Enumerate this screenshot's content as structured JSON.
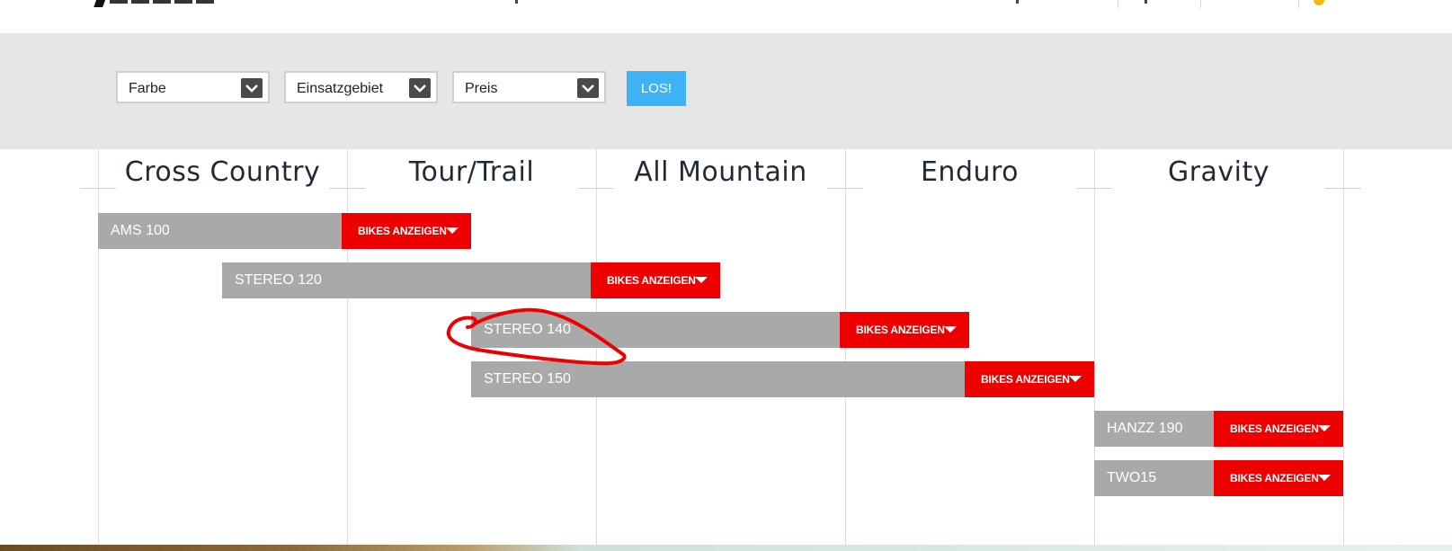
{
  "filters": {
    "color_label": "Farbe",
    "usage_label": "Einsatzgebiet",
    "price_label": "Preis",
    "go_label": "LOS!"
  },
  "categories": [
    "Cross Country",
    "Tour/Trail",
    "All Mountain",
    "Enduro",
    "Gravity"
  ],
  "bikes": [
    {
      "name": "AMS 100",
      "button": "BIKES ANZEIGEN"
    },
    {
      "name": "STEREO 120",
      "button": "BIKES ANZEIGEN"
    },
    {
      "name": "STEREO 140",
      "button": "BIKES ANZEIGEN"
    },
    {
      "name": "STEREO 150",
      "button": "BIKES ANZEIGEN"
    },
    {
      "name": "HANZZ 190",
      "button": "BIKES ANZEIGEN"
    },
    {
      "name": "TWO15",
      "button": "BIKES ANZEIGEN"
    }
  ],
  "colors": {
    "bar": "#a9a9a9",
    "button": "#ee0000",
    "go_button": "#3fb1f5",
    "annotation": "#ee0000"
  }
}
